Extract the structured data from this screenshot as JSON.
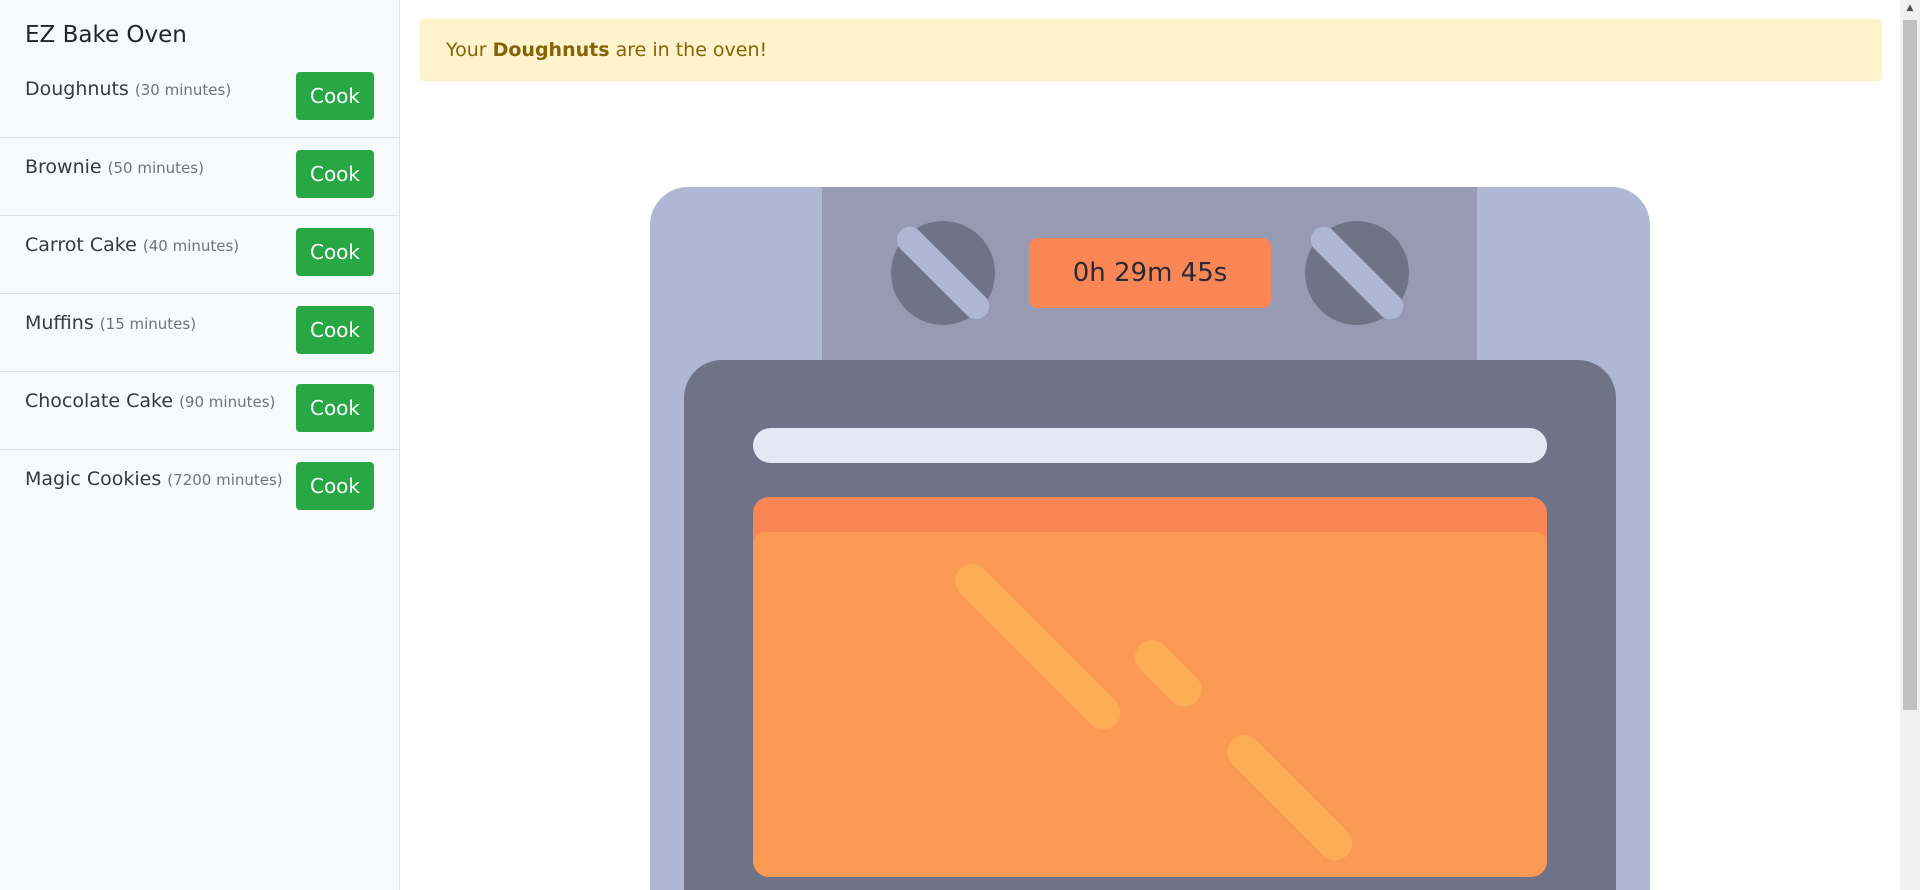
{
  "app": {
    "title": "EZ Bake Oven"
  },
  "recipes": [
    {
      "name": "Doughnuts",
      "duration": "(30 minutes)",
      "button": "Cook"
    },
    {
      "name": "Brownie",
      "duration": "(50 minutes)",
      "button": "Cook"
    },
    {
      "name": "Carrot Cake",
      "duration": "(40 minutes)",
      "button": "Cook"
    },
    {
      "name": "Muffins",
      "duration": "(15 minutes)",
      "button": "Cook"
    },
    {
      "name": "Chocolate Cake",
      "duration": "(90 minutes)",
      "button": "Cook"
    },
    {
      "name": "Magic Cookies",
      "duration": "(7200 minutes)",
      "button": "Cook"
    }
  ],
  "alert": {
    "prefix": "Your ",
    "item": "Doughnuts",
    "suffix": " are in the oven!"
  },
  "oven": {
    "timer": "0h 29m 45s"
  },
  "colors": {
    "cook_button": "#28a745",
    "alert_bg": "#fff3cd",
    "alert_text": "#856404",
    "oven_body": "#aeb8d3",
    "oven_panel": "#969bb3",
    "oven_door": "#6e7388",
    "timer_bg": "#fa8656",
    "window": "#fa9a54"
  },
  "icons": {
    "knob_left": "oven-knob-icon",
    "knob_right": "oven-knob-icon"
  }
}
